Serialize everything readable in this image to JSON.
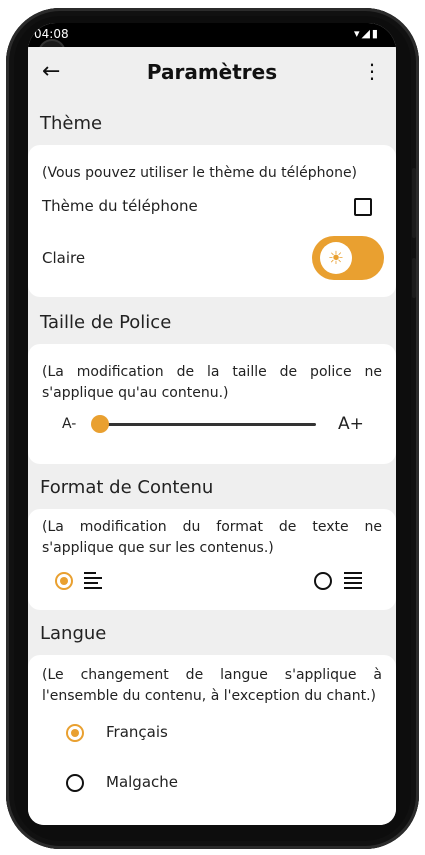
{
  "status": {
    "time": "04:08",
    "icons": "▾◢▮"
  },
  "appbar": {
    "back": "←",
    "title": "Paramètres",
    "menu": "⋮"
  },
  "theme": {
    "heading": "Thème",
    "note": "(Vous pouvez utiliser le thème du téléphone)",
    "phone_theme_label": "Thème du téléphone",
    "phone_theme_checked": false,
    "light_label": "Claire",
    "light_on": true,
    "sun": "☀"
  },
  "font": {
    "heading": "Taille de Police",
    "note": "(La modification de la taille de police ne s'applique qu'au contenu.)",
    "min_label": "A-",
    "max_label": "A+",
    "level": 0
  },
  "format": {
    "heading": "Format de Contenu",
    "note": "(La modification du format de texte ne s'applique que sur les contenus.)",
    "selected": "left"
  },
  "language": {
    "heading": "Langue",
    "note": "(Le changement de langue s'applique à l'ensemble du contenu, à l'exception du chant.)",
    "options": [
      {
        "label": "Français",
        "selected": true
      },
      {
        "label": "Malgache",
        "selected": false
      }
    ]
  },
  "colors": {
    "accent": "#e9a030",
    "background": "#efefef",
    "card": "#ffffff"
  }
}
